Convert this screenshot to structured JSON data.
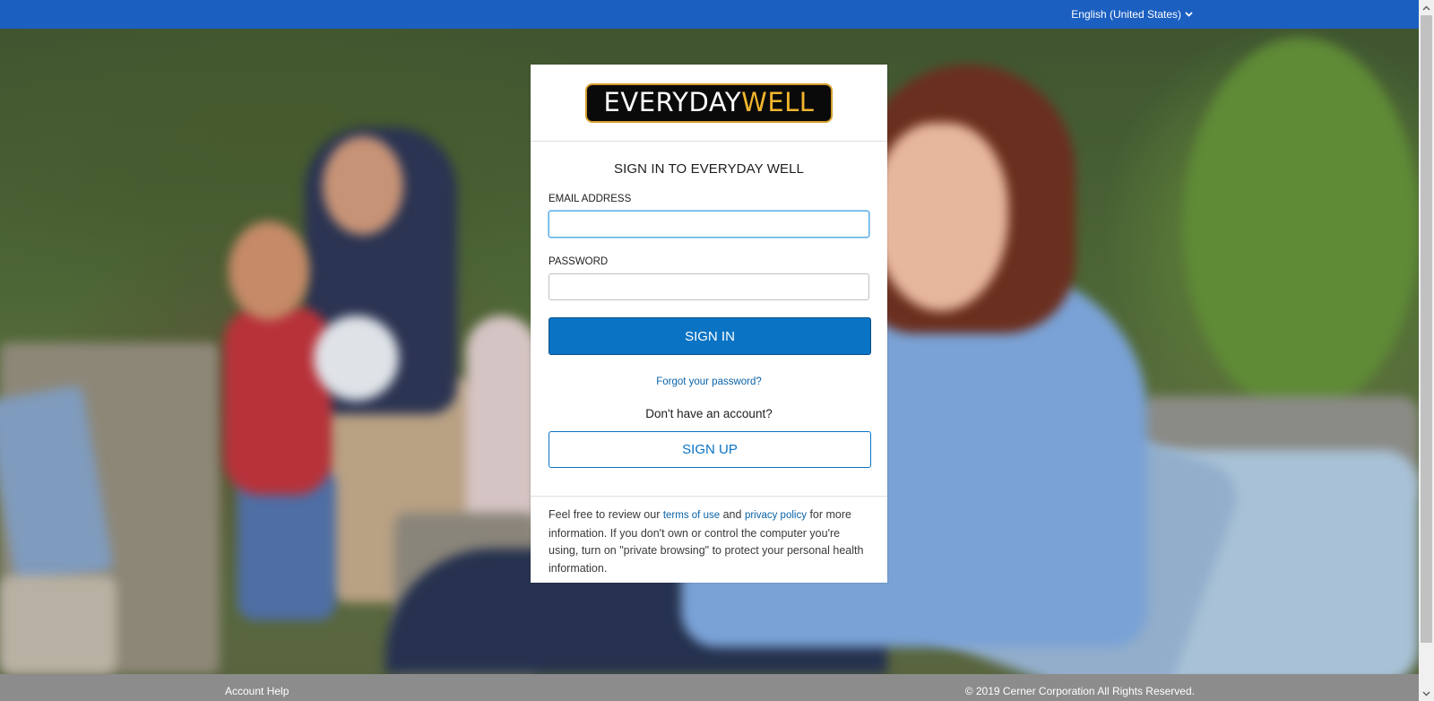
{
  "topbar": {
    "language": "English (United States)",
    "language_icon": "chevron-down-icon"
  },
  "brand": {
    "logo_part1": "EVERYDAY",
    "logo_part2": "WELL",
    "logo_colors": {
      "background": "#0a0a0a",
      "text": "#ffffff",
      "accent": "#f1b52c"
    }
  },
  "signin": {
    "title": "SIGN IN TO EVERYDAY WELL",
    "email_label": "EMAIL ADDRESS",
    "email_value": "",
    "password_label": "PASSWORD",
    "password_value": "",
    "signin_button": "SIGN IN",
    "forgot_link": "Forgot your password?",
    "no_account_text": "Don't have an account?",
    "signup_button": "SIGN UP"
  },
  "disclaimer": {
    "prefix": "Feel free to review our ",
    "terms_link": "terms of use",
    "and_text": " and ",
    "privacy_link": "privacy policy",
    "suffix": " for more information. If you don't own or control the computer you're using, turn on \"private browsing\" to protect your personal health information."
  },
  "footer": {
    "help_link": "Account Help",
    "copyright": "© 2019 Cerner Corporation All Rights Reserved."
  },
  "colors": {
    "topbar": "#1b5fc1",
    "primary_button": "#0a73c4",
    "footer": "#8c8c8c"
  }
}
